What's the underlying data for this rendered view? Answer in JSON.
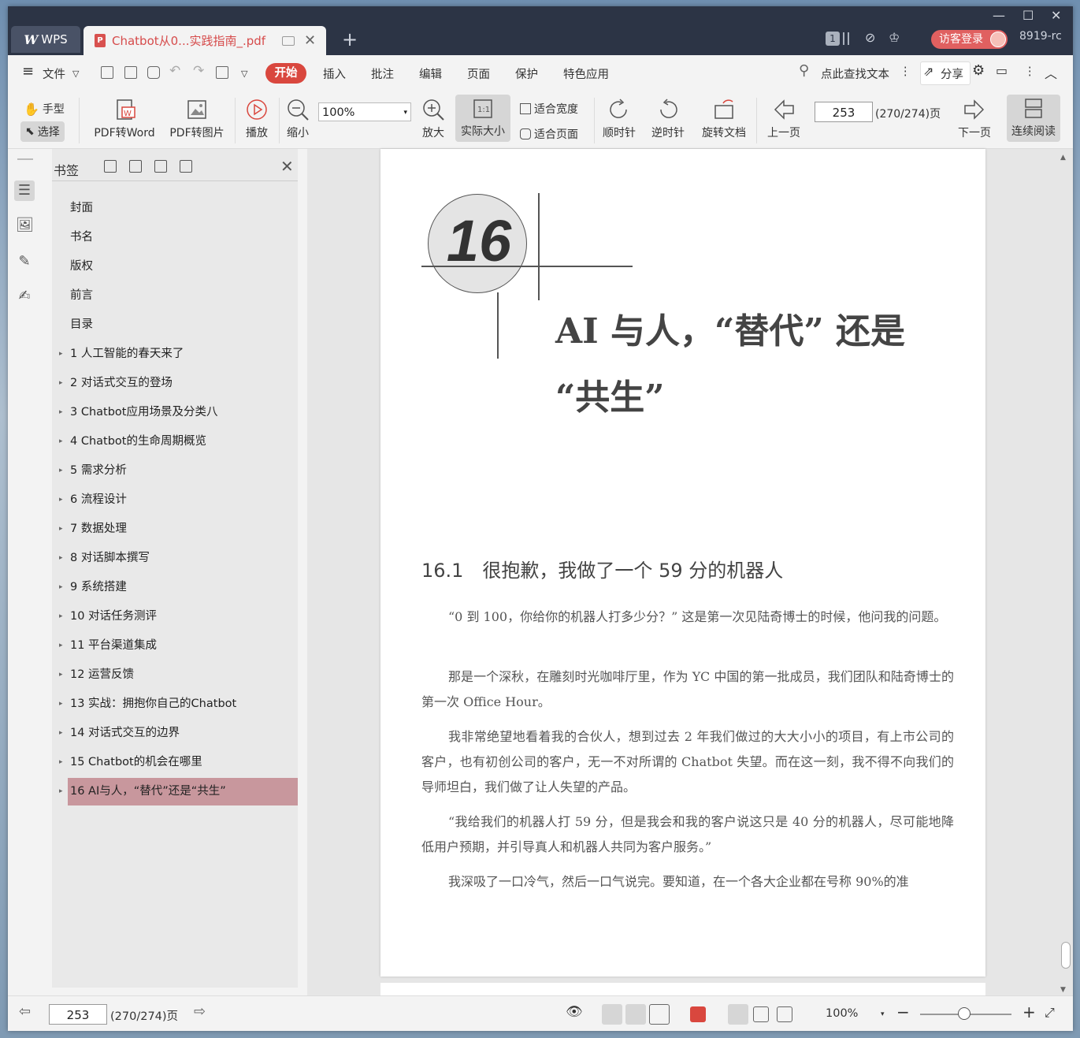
{
  "titlebar": {
    "app_tab": "WPS",
    "doc_tab": "Chatbot从0...实践指南_.pdf",
    "badge": "1",
    "login": "访客登录",
    "user": "8919-rc"
  },
  "menu": {
    "file": "文件",
    "tabs": [
      "开始",
      "插入",
      "批注",
      "编辑",
      "页面",
      "保护",
      "特色应用"
    ],
    "search": "点此查找文本",
    "share": "分享"
  },
  "ribbon": {
    "hand": "手型",
    "select": "选择",
    "pdf_word": "PDF转Word",
    "pdf_img": "PDF转图片",
    "play": "播放",
    "zoom_out": "缩小",
    "zoom_value": "100%",
    "zoom_in": "放大",
    "actual": "实际大小",
    "fit_width": "适合宽度",
    "fit_page": "适合页面",
    "cw": "顺时针",
    "ccw": "逆时针",
    "rotate": "旋转文档",
    "prev": "上一页",
    "page": "253",
    "page_total": "(270/274)页",
    "next": "下一页",
    "continuous": "连续阅读"
  },
  "panel": {
    "title": "书签",
    "items": [
      {
        "label": "封面"
      },
      {
        "label": "书名"
      },
      {
        "label": "版权"
      },
      {
        "label": "前言"
      },
      {
        "label": "目录"
      },
      {
        "label": "1 人工智能的春天来了"
      },
      {
        "label": "2 对话式交互的登场"
      },
      {
        "label": "3 Chatbot应用场景及分类八"
      },
      {
        "label": "4 Chatbot的生命周期概览"
      },
      {
        "label": "5 需求分析"
      },
      {
        "label": "6 流程设计"
      },
      {
        "label": "7 数据处理"
      },
      {
        "label": "8 对话脚本撰写"
      },
      {
        "label": "9 系统搭建"
      },
      {
        "label": "10 对话任务测评"
      },
      {
        "label": "11 平台渠道集成"
      },
      {
        "label": "12 运营反馈"
      },
      {
        "label": "13 实战：拥抱你自己的Chatbot"
      },
      {
        "label": "14 对话式交互的边界"
      },
      {
        "label": "15 Chatbot的机会在哪里"
      },
      {
        "label": "16 AI与人，“替代”还是“共生”"
      }
    ]
  },
  "document": {
    "chapter_num": "16",
    "chapter_title_1": "AI 与人，“替代” 还是",
    "chapter_title_2": "“共生”",
    "section": "16.1　很抱歉，我做了一个 59 分的机器人",
    "paragraphs": [
      "“0 到 100，你给你的机器人打多少分？” 这是第一次见陆奇博士的时候，他问我的问题。",
      "那是一个深秋，在雕刻时光咖啡厅里，作为 YC 中国的第一批成员，我们团队和陆奇博士的第一次 Office Hour。",
      "我非常绝望地看着我的合伙人，想到过去 2 年我们做过的大大小小的项目，有上市公司的客户，也有初创公司的客户，无一不对所谓的 Chatbot 失望。而在这一刻，我不得不向我们的导师坦白，我们做了让人失望的产品。",
      "“我给我们的机器人打 59 分，但是我会和我的客户说这只是 40 分的机器人，尽可能地降低用户预期，并引导真人和机器人共同为客户服务。”",
      "我深吸了一口冷气，然后一口气说完。要知道，在一个各大企业都在号称 90%的准"
    ]
  },
  "status": {
    "page": "253",
    "page_total": "(270/274)页",
    "zoom": "100%"
  }
}
